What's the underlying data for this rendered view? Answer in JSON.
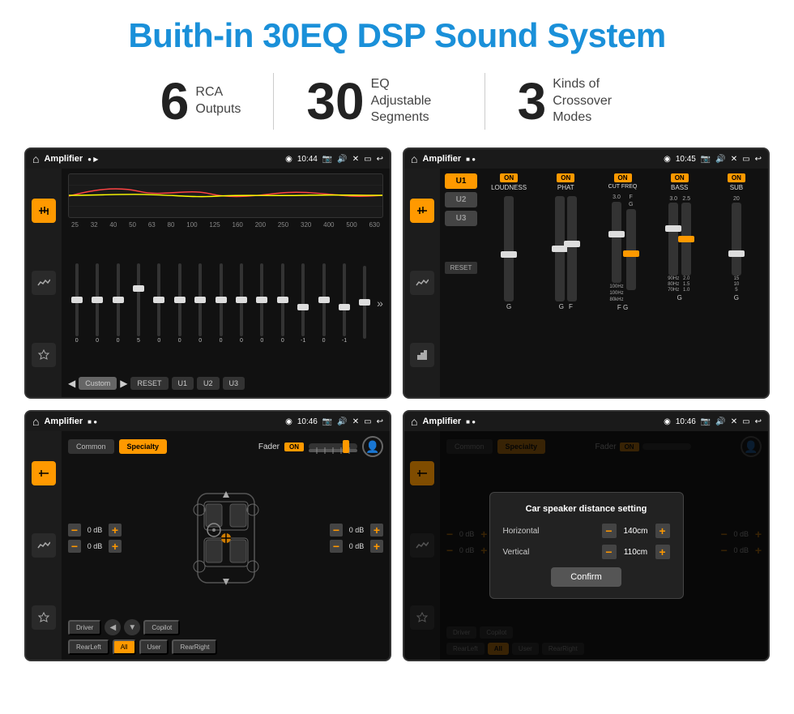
{
  "title": "Buith-in 30EQ DSP Sound System",
  "stats": [
    {
      "number": "6",
      "text": "RCA\nOutputs"
    },
    {
      "number": "30",
      "text": "EQ Adjustable\nSegments"
    },
    {
      "number": "3",
      "text": "Kinds of\nCrossover Modes"
    }
  ],
  "screens": [
    {
      "id": "eq-screen",
      "status": {
        "title": "Amplifier",
        "time": "10:44"
      },
      "type": "eq"
    },
    {
      "id": "crossover-screen",
      "status": {
        "title": "Amplifier",
        "time": "10:45"
      },
      "type": "crossover"
    },
    {
      "id": "fader-screen",
      "status": {
        "title": "Amplifier",
        "time": "10:46"
      },
      "type": "fader"
    },
    {
      "id": "dialog-screen",
      "status": {
        "title": "Amplifier",
        "time": "10:46"
      },
      "type": "dialog"
    }
  ],
  "eq": {
    "freqs": [
      "25",
      "32",
      "40",
      "50",
      "63",
      "80",
      "100",
      "125",
      "160",
      "200",
      "250",
      "320",
      "400",
      "500",
      "630"
    ],
    "values": [
      "0",
      "0",
      "0",
      "5",
      "0",
      "0",
      "0",
      "0",
      "0",
      "0",
      "0",
      "-1",
      "0",
      "-1",
      ""
    ],
    "preset": "Custom",
    "buttons": [
      "RESET",
      "U1",
      "U2",
      "U3"
    ]
  },
  "crossover": {
    "presets": [
      "U1",
      "U2",
      "U3"
    ],
    "controls": [
      {
        "label": "LOUDNESS",
        "on": true
      },
      {
        "label": "PHAT",
        "on": true
      },
      {
        "label": "CUT FREQ",
        "on": true
      },
      {
        "label": "BASS",
        "on": true
      },
      {
        "label": "SUB",
        "on": true
      }
    ],
    "reset": "RESET"
  },
  "fader": {
    "tabs": [
      "Common",
      "Specialty"
    ],
    "activeTab": "Specialty",
    "faderLabel": "Fader",
    "onLabel": "ON",
    "positions": [
      "Driver",
      "Copilot",
      "RearLeft",
      "All",
      "User",
      "RearRight"
    ],
    "dbValues": [
      "0 dB",
      "0 dB",
      "0 dB",
      "0 dB"
    ]
  },
  "dialog": {
    "title": "Car speaker distance setting",
    "horizontal": {
      "label": "Horizontal",
      "value": "140cm"
    },
    "vertical": {
      "label": "Vertical",
      "value": "110cm"
    },
    "confirmLabel": "Confirm",
    "fader": {
      "tabs": [
        "Common",
        "Specialty"
      ],
      "positions": [
        "Driver",
        "Copilot",
        "RearLeft",
        "All",
        "User",
        "RearRight"
      ]
    }
  },
  "icons": {
    "home": "⌂",
    "location": "◉",
    "play": "▶",
    "back_arrow": "↩",
    "settings": "⚙",
    "sound_wave": "≋",
    "equalizer": "≡",
    "speaker": "♪",
    "chevron_right": "»",
    "chevron_left": "«"
  }
}
